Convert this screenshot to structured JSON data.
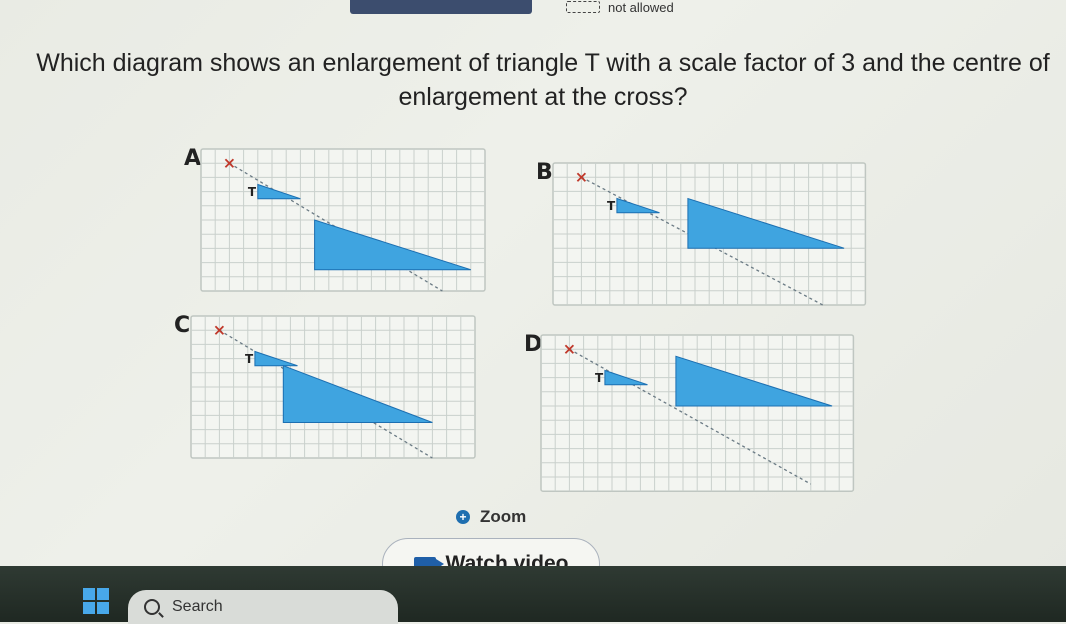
{
  "header": {
    "status_text": "not allowed"
  },
  "question": {
    "text": "Which diagram shows an enlargement of triangle T with a scale factor of 3 and the centre of enlargement at the cross?"
  },
  "options": [
    {
      "letter": "A",
      "triangle_label": "T"
    },
    {
      "letter": "B",
      "triangle_label": "T"
    },
    {
      "letter": "C",
      "triangle_label": "T"
    },
    {
      "letter": "D",
      "triangle_label": "T"
    }
  ],
  "actions": {
    "zoom_label": "Zoom",
    "watch_video_label": "Watch video"
  },
  "taskbar": {
    "search_label": "Search"
  },
  "colors": {
    "triangle_fill": "#3fa4e0",
    "triangle_stroke": "#1c6fb1",
    "cross": "#c0392b",
    "grid_line": "#c9d0cc",
    "panel_bg": "#f3f5f1"
  }
}
